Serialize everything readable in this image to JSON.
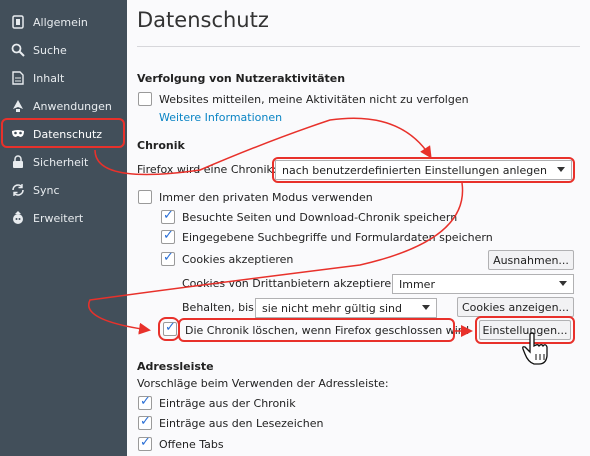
{
  "sidebar": {
    "items": [
      {
        "label": "Allgemein",
        "icon": "general-icon"
      },
      {
        "label": "Suche",
        "icon": "search-icon"
      },
      {
        "label": "Inhalt",
        "icon": "content-icon"
      },
      {
        "label": "Anwendungen",
        "icon": "applications-icon"
      },
      {
        "label": "Datenschutz",
        "icon": "privacy-mask-icon",
        "active": true
      },
      {
        "label": "Sicherheit",
        "icon": "security-lock-icon"
      },
      {
        "label": "Sync",
        "icon": "sync-icon"
      },
      {
        "label": "Erweitert",
        "icon": "advanced-wizard-icon"
      }
    ]
  },
  "page": {
    "title": "Datenschutz"
  },
  "tracking": {
    "heading": "Verfolgung von Nutzeraktivitäten",
    "dnt_label": "Websites mitteilen, meine Aktivitäten nicht zu verfolgen",
    "dnt_checked": false,
    "more_info": "Weitere Informationen"
  },
  "history": {
    "heading": "Chronik",
    "firefox_will_label": "Firefox wird eine Chronik:",
    "mode_select": "nach benutzerdefinierten Einstellungen anlegen",
    "private_mode": "Immer den privaten Modus verwenden",
    "private_checked": false,
    "visited": "Besuchte Seiten und Download-Chronik speichern",
    "visited_checked": true,
    "search_forms": "Eingegebene Suchbegriffe und Formulardaten speichern",
    "search_checked": true,
    "cookies": "Cookies akzeptieren",
    "cookies_checked": true,
    "exceptions_button": "Ausnahmen...",
    "third_party_label": "Cookies von Drittanbietern akzeptieren:",
    "third_party_select": "Immer",
    "keep_until_label": "Behalten, bis:",
    "keep_until_select": "sie nicht mehr gültig sind",
    "show_cookies_button": "Cookies anzeigen...",
    "clear_on_close": "Die Chronik löschen, wenn Firefox geschlossen wird",
    "clear_checked": true,
    "settings_button": "Einstellungen..."
  },
  "addressbar": {
    "heading": "Adressleiste",
    "suggest_label": "Vorschläge beim Verwenden der Adressleiste:",
    "history": "Einträge aus der Chronik",
    "bookmarks": "Einträge aus den Lesezeichen",
    "open_tabs": "Offene Tabs"
  },
  "colors": {
    "sidebar": "#424f5a",
    "annotation_red": "#e8312b",
    "link": "#0a84c4",
    "check": "#2a6fd6"
  }
}
